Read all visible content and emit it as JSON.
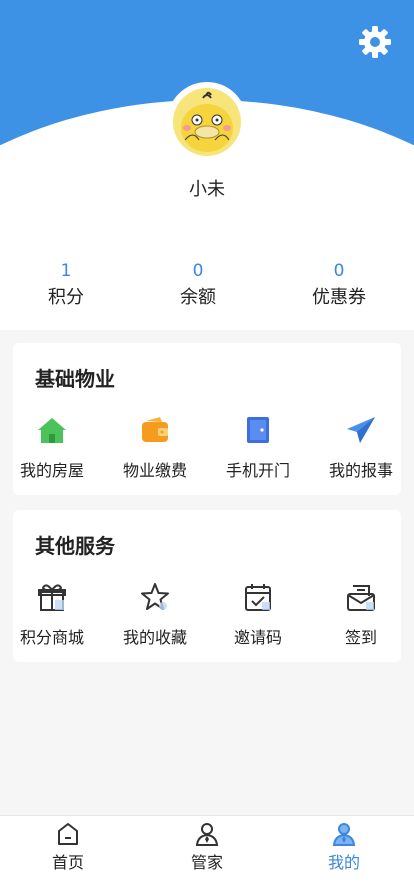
{
  "user": {
    "name": "小未"
  },
  "stats": [
    {
      "value": "1",
      "label": "积分"
    },
    {
      "value": "0",
      "label": "余额"
    },
    {
      "value": "0",
      "label": "优惠券"
    }
  ],
  "basic": {
    "title": "基础物业",
    "items": [
      {
        "label": "我的房屋",
        "icon": "house-icon"
      },
      {
        "label": "物业缴费",
        "icon": "wallet-icon"
      },
      {
        "label": "手机开门",
        "icon": "door-icon"
      },
      {
        "label": "我的报事",
        "icon": "paper-plane-icon"
      }
    ]
  },
  "other": {
    "title": "其他服务",
    "items": [
      {
        "label": "积分商城",
        "icon": "gift-icon"
      },
      {
        "label": "我的收藏",
        "icon": "star-icon"
      },
      {
        "label": "邀请码",
        "icon": "calendar-check-icon"
      },
      {
        "label": "签到",
        "icon": "mail-icon"
      }
    ]
  },
  "tabbar": [
    {
      "label": "首页",
      "icon": "home-icon"
    },
    {
      "label": "管家",
      "icon": "butler-icon"
    },
    {
      "label": "我的",
      "icon": "profile-icon",
      "active": true
    }
  ],
  "colors": {
    "brand": "#3d92e6",
    "accent": "#3a86e2"
  }
}
